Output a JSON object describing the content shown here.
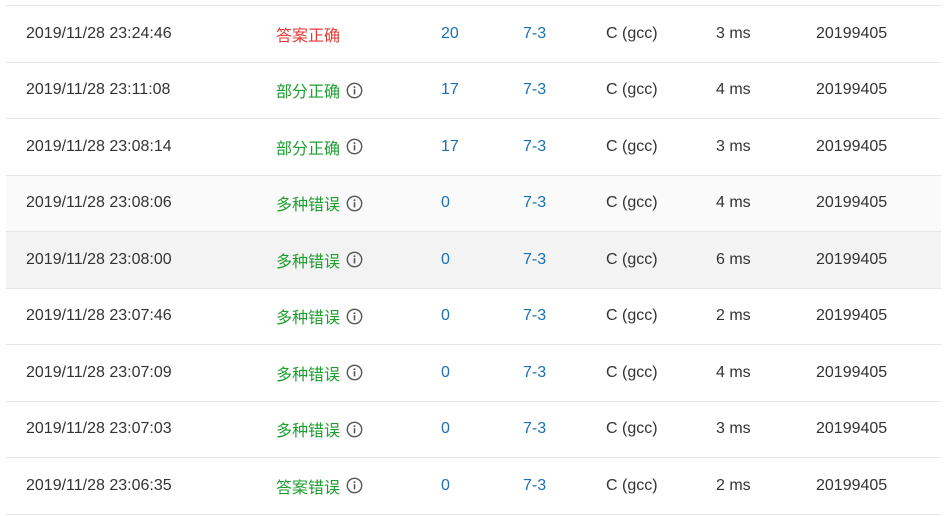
{
  "colors": {
    "accepted": "#e53935",
    "partial": "#1e9e30",
    "link": "#1a6fb5",
    "text": "#333333"
  },
  "submissions": [
    {
      "time": "2019/11/28 23:24:46",
      "status": "答案正确",
      "status_color": "#e53935",
      "show_info": false,
      "score": "20",
      "problem": "7-3",
      "language": "C (gcc)",
      "runtime": "3 ms",
      "user": "20199405"
    },
    {
      "time": "2019/11/28 23:11:08",
      "status": "部分正确",
      "status_color": "#1e9e30",
      "show_info": true,
      "score": "17",
      "problem": "7-3",
      "language": "C (gcc)",
      "runtime": "4 ms",
      "user": "20199405"
    },
    {
      "time": "2019/11/28 23:08:14",
      "status": "部分正确",
      "status_color": "#1e9e30",
      "show_info": true,
      "score": "17",
      "problem": "7-3",
      "language": "C (gcc)",
      "runtime": "3 ms",
      "user": "20199405"
    },
    {
      "time": "2019/11/28 23:08:06",
      "status": "多种错误",
      "status_color": "#1e9e30",
      "show_info": true,
      "score": "0",
      "problem": "7-3",
      "language": "C (gcc)",
      "runtime": "4 ms",
      "user": "20199405"
    },
    {
      "time": "2019/11/28 23:08:00",
      "status": "多种错误",
      "status_color": "#1e9e30",
      "show_info": true,
      "score": "0",
      "problem": "7-3",
      "language": "C (gcc)",
      "runtime": "6 ms",
      "user": "20199405"
    },
    {
      "time": "2019/11/28 23:07:46",
      "status": "多种错误",
      "status_color": "#1e9e30",
      "show_info": true,
      "score": "0",
      "problem": "7-3",
      "language": "C (gcc)",
      "runtime": "2 ms",
      "user": "20199405"
    },
    {
      "time": "2019/11/28 23:07:09",
      "status": "多种错误",
      "status_color": "#1e9e30",
      "show_info": true,
      "score": "0",
      "problem": "7-3",
      "language": "C (gcc)",
      "runtime": "4 ms",
      "user": "20199405"
    },
    {
      "time": "2019/11/28 23:07:03",
      "status": "多种错误",
      "status_color": "#1e9e30",
      "show_info": true,
      "score": "0",
      "problem": "7-3",
      "language": "C (gcc)",
      "runtime": "3 ms",
      "user": "20199405"
    },
    {
      "time": "2019/11/28 23:06:35",
      "status": "答案错误",
      "status_color": "#1e9e30",
      "show_info": true,
      "score": "0",
      "problem": "7-3",
      "language": "C (gcc)",
      "runtime": "2 ms",
      "user": "20199405"
    }
  ]
}
